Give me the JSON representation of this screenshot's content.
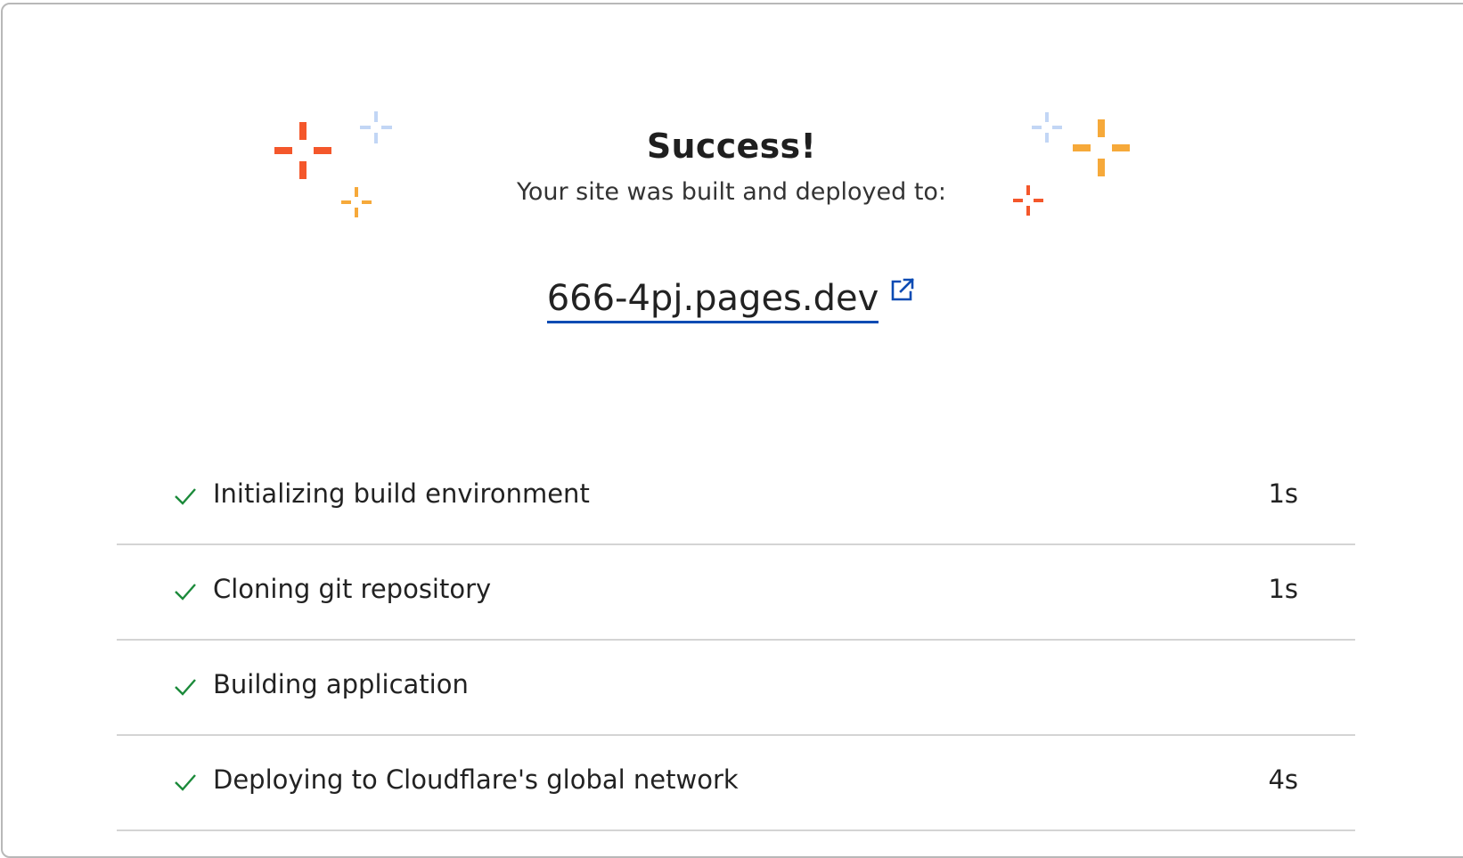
{
  "success": {
    "title": "Success!",
    "subtitle": "Your site was built and deployed to:",
    "site_url": "666-4pj.pages.dev",
    "link_color": "#0b4bb3"
  },
  "sparkle_colors": {
    "red": "#f4572b",
    "orange": "#f6a93a",
    "light_blue": "#c2d6f5"
  },
  "steps": [
    {
      "label": "Initializing build environment",
      "time": "1s",
      "status": "done"
    },
    {
      "label": "Cloning git repository",
      "time": "1s",
      "status": "done"
    },
    {
      "label": "Building application",
      "time": "",
      "status": "done"
    },
    {
      "label": "Deploying to Cloudflare's global network",
      "time": "4s",
      "status": "done"
    }
  ],
  "icons": {
    "check": "check-icon",
    "external": "external-link-icon",
    "sparkle": "sparkle-icon"
  },
  "check_color": "#1b8a3a"
}
